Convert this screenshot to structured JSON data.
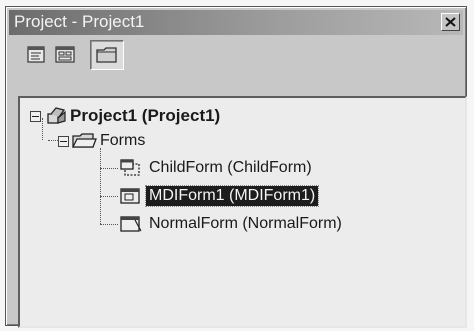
{
  "window": {
    "title": "Project - Project1"
  },
  "toolbar": {
    "view_code_icon": "view-code-icon",
    "view_object_icon": "view-object-icon",
    "toggle_folders_icon": "toggle-folders-icon"
  },
  "tree": {
    "root": {
      "label": "Project1 (Project1)",
      "icon": "project-icon",
      "expanded": true
    },
    "folder": {
      "label": "Forms",
      "icon": "folder-icon",
      "expanded": true
    },
    "items": [
      {
        "label": "ChildForm (ChildForm)",
        "icon": "mdi-child-form-icon",
        "selected": false
      },
      {
        "label": "MDIForm1 (MDIForm1)",
        "icon": "mdi-form-icon",
        "selected": true
      },
      {
        "label": "NormalForm (NormalForm)",
        "icon": "form-icon",
        "selected": false
      }
    ]
  },
  "colors": {
    "selection_bg": "#1c1c1c",
    "panel_bg": "#ececec",
    "window_bg": "#c8c8c8"
  }
}
